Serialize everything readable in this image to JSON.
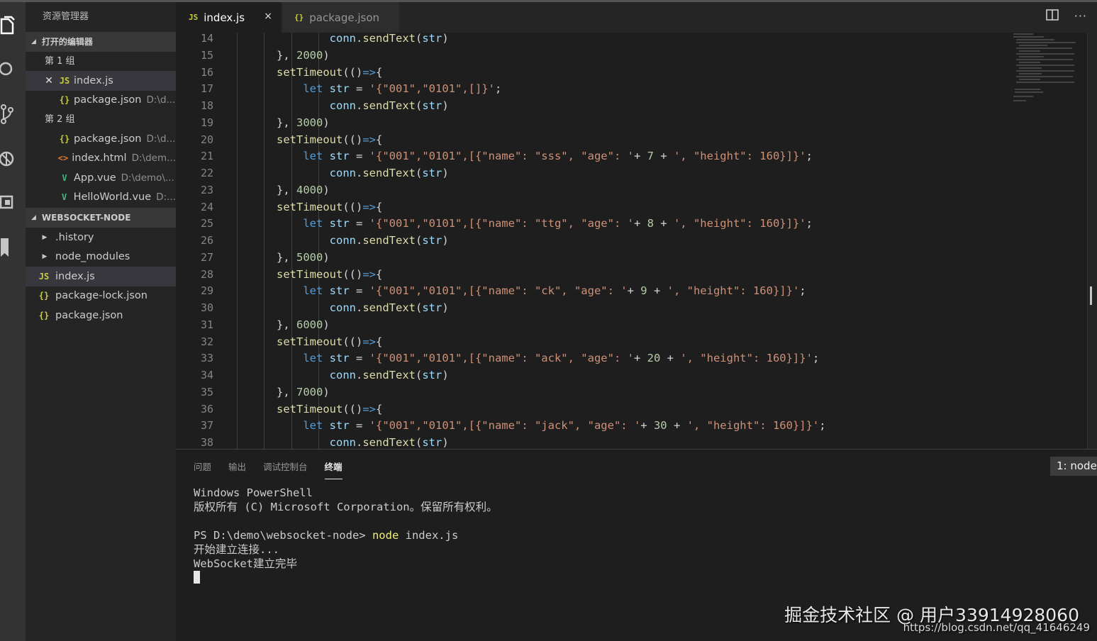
{
  "sidebar": {
    "title": "资源管理器",
    "open_editors": {
      "label": "打开的编辑器",
      "groups": [
        {
          "label": "第 1 组",
          "items": [
            {
              "icon": "JS",
              "name": "index.js",
              "desc": ""
            },
            {
              "icon": "{}",
              "name": "package.json",
              "desc": "D:\\d..."
            }
          ]
        },
        {
          "label": "第 2 组",
          "items": [
            {
              "icon": "{}",
              "name": "package.json",
              "desc": "D:\\d..."
            },
            {
              "icon": "<>",
              "name": "index.html",
              "desc": "D:\\dem..."
            },
            {
              "icon": "V",
              "name": "App.vue",
              "desc": "D:\\demo\\..."
            },
            {
              "icon": "V",
              "name": "HelloWorld.vue",
              "desc": "D:..."
            }
          ]
        }
      ]
    },
    "project": {
      "label": "WEBSOCKET-NODE",
      "items": [
        {
          "icon": "",
          "name": ".history"
        },
        {
          "icon": "",
          "name": "node_modules"
        },
        {
          "icon": "JS",
          "name": "index.js"
        },
        {
          "icon": "{}",
          "name": "package-lock.json"
        },
        {
          "icon": "{}",
          "name": "package.json"
        }
      ]
    }
  },
  "tabs": [
    {
      "icon": "JS",
      "label": "index.js",
      "close": "×"
    },
    {
      "icon": "{}",
      "label": "package.json"
    }
  ],
  "editor": {
    "line_numbers": [
      "14",
      "15",
      "16",
      "17",
      "18",
      "19",
      "20",
      "21",
      "22",
      "23",
      "24",
      "25",
      "26",
      "27",
      "28",
      "29",
      "30",
      "31",
      "32",
      "33",
      "34",
      "35",
      "36",
      "37",
      "38"
    ]
  },
  "panel": {
    "tabs": [
      "问题",
      "输出",
      "调试控制台",
      "终端"
    ],
    "active_tab": "终端",
    "terminal_select": "1: node",
    "terminal_lines": {
      "l1": "Windows PowerShell",
      "l2": "版权所有 (C) Microsoft Corporation。保留所有权利。",
      "prompt": "PS D:\\demo\\websocket-node> ",
      "cmd": "node",
      "arg": " index.js",
      "l4": "开始建立连接...",
      "l5": "WebSocket建立完毕"
    }
  },
  "watermark": {
    "line1": "掘金技术社区 @ 用户33914928060",
    "line2": "https://blog.csdn.net/qq_41646249"
  },
  "colors": {
    "keyword": "#569cd6",
    "function": "#dcdcaa",
    "string": "#ce9178",
    "number": "#b5cea8",
    "accent_cmd": "#f0f07a"
  }
}
